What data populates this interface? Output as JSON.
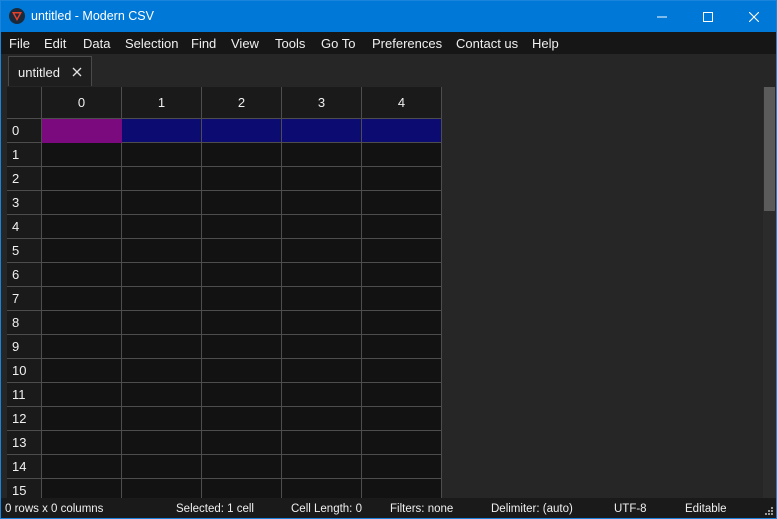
{
  "window": {
    "title": "untitled - Modern CSV",
    "icon": "modern-csv-logo-icon",
    "controls": [
      "minimize-icon",
      "maximize-icon",
      "close-icon"
    ]
  },
  "menu": [
    "File",
    "Edit",
    "Data",
    "Selection",
    "Find",
    "View",
    "Tools",
    "Go To",
    "Preferences",
    "Contact us",
    "Help"
  ],
  "tabs": [
    {
      "label": "untitled",
      "close_icon": "close-icon"
    }
  ],
  "grid": {
    "column_headers": [
      "0",
      "1",
      "2",
      "3",
      "4"
    ],
    "row_headers": [
      "0",
      "1",
      "2",
      "3",
      "4",
      "5",
      "6",
      "7",
      "8",
      "9",
      "10",
      "11",
      "12",
      "13",
      "14",
      "15"
    ],
    "selected_cell": {
      "row": 0,
      "column": 0
    },
    "colors": {
      "current_cell": "#7a0a7e",
      "selected_row": "#0b0b72",
      "cell_background": "#121212",
      "grid_lines": "#4d4d4d"
    }
  },
  "status": {
    "size": "0 rows x 0 columns",
    "selected": "Selected: 1 cell",
    "cell_length": "Cell Length: 0",
    "filters": "Filters: none",
    "delimiter": "Delimiter: (auto)",
    "encoding": "UTF-8",
    "mode": "Editable"
  },
  "accent_color": "#0078d7"
}
